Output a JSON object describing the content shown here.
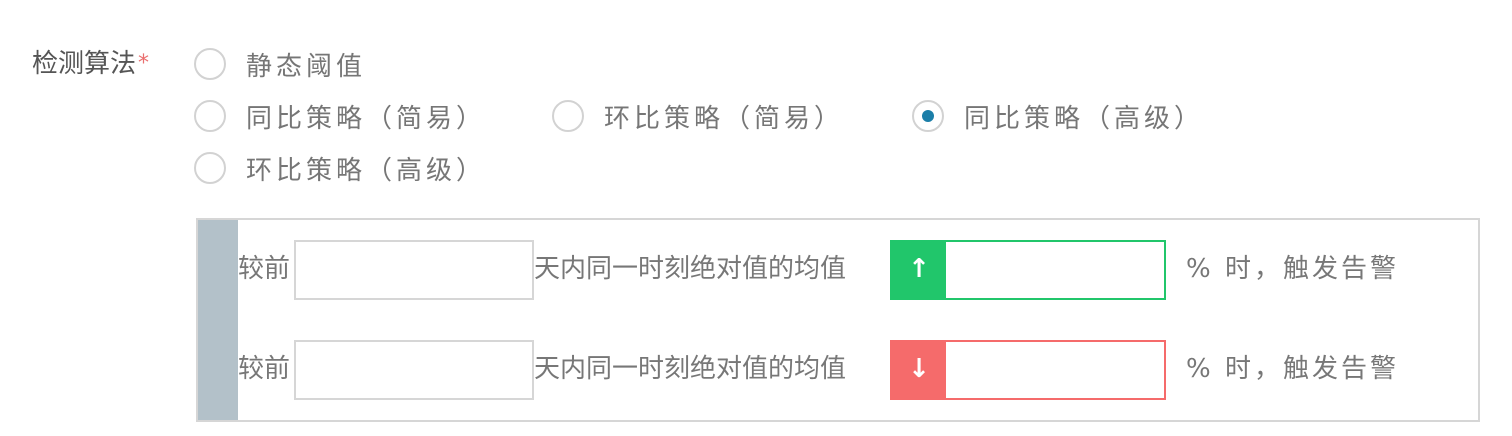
{
  "field": {
    "label": "检测算法",
    "required_mark": "*"
  },
  "algorithms": {
    "selected_index": 2,
    "options": [
      {
        "label": "静态阈值",
        "checked": false
      },
      {
        "label": "同比策略（简易）",
        "checked": false
      },
      {
        "label": "环比策略（简易）",
        "checked": false
      },
      {
        "label": "同比策略（高级）",
        "checked": true
      },
      {
        "label": "环比策略（高级）",
        "checked": false
      }
    ]
  },
  "rules": [
    {
      "direction": "up",
      "prefix": "较前",
      "days_value": "",
      "middle": "天内同一时刻绝对值的均值",
      "arrow": "↑",
      "arrow_icon": "arrow-up-icon",
      "percent_value": "",
      "suffix": "% 时，触发告警",
      "color": "#21c66b"
    },
    {
      "direction": "down",
      "prefix": "较前",
      "days_value": "",
      "middle": "天内同一时刻绝对值的均值",
      "arrow": "↓",
      "arrow_icon": "arrow-down-icon",
      "percent_value": "",
      "suffix": "% 时，触发告警",
      "color": "#f56b6b"
    }
  ],
  "colors": {
    "radio_checked": "#1b7ea8",
    "required": "#ea6f6f",
    "stripe": "#b3c1c9"
  }
}
